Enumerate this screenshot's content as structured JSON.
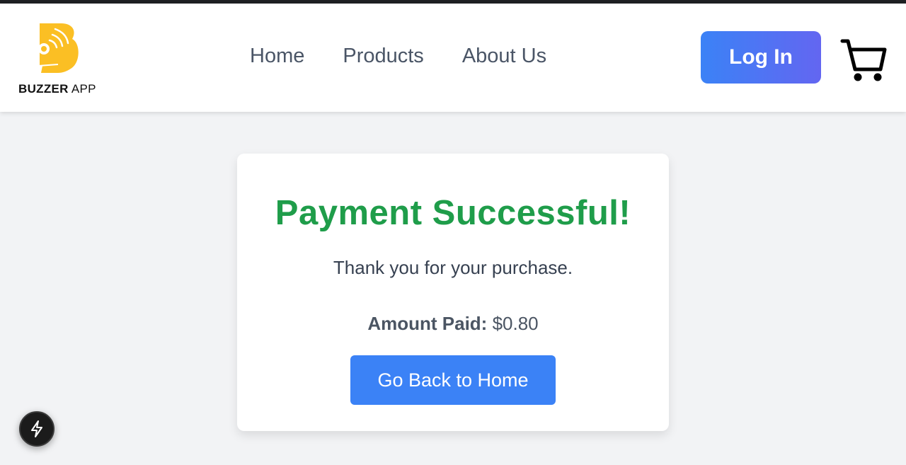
{
  "header": {
    "brand_bold": "BUZZER",
    "brand_regular": " APP",
    "nav": [
      {
        "label": "Home"
      },
      {
        "label": "Products"
      },
      {
        "label": "About Us"
      }
    ],
    "login_label": "Log In",
    "colors": {
      "brand": "#fbbf24",
      "login_gradient_start": "#3b82f6",
      "login_gradient_end": "#6366f1"
    },
    "icons": {
      "logo": "buzzer-logo-icon",
      "cart": "shopping-cart-icon"
    }
  },
  "main": {
    "title": "Payment Successful!",
    "message": "Thank you for your purchase.",
    "amount_label": "Amount Paid:",
    "amount_value": "$0.80",
    "home_button_label": "Go Back to Home",
    "colors": {
      "title": "#1f9d4a",
      "button": "#3b82f6"
    }
  },
  "floating": {
    "icon": "lightning-bolt-icon"
  }
}
